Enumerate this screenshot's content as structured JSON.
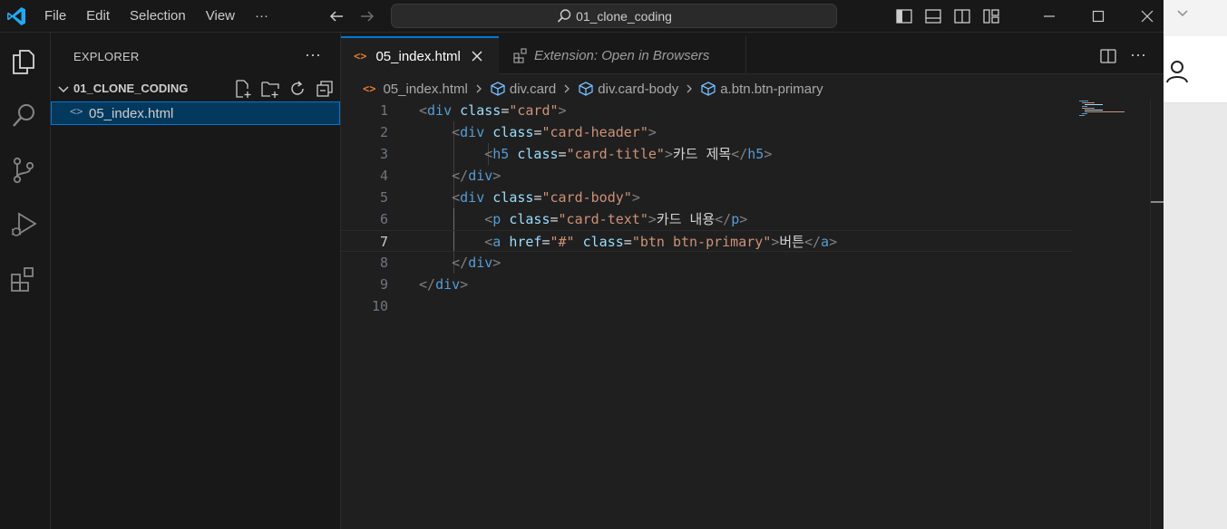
{
  "titlebar": {
    "menu": [
      "File",
      "Edit",
      "Selection",
      "View",
      "···"
    ],
    "command_center": "01_clone_coding"
  },
  "sidebar": {
    "title": "EXPLORER",
    "more": "···",
    "folder_name": "01_CLONE_CODING",
    "file_icon": "<>",
    "files": [
      "05_index.html"
    ]
  },
  "tabs": {
    "active": "05_index.html",
    "inactive": "Extension: Open in Browsers",
    "html_icon": "<>"
  },
  "editor_actions": {
    "more": "···"
  },
  "breadcrumb": {
    "html_icon": "<>",
    "file": "05_index.html",
    "items": [
      "div.card",
      "div.card-body",
      "a.btn.btn-primary"
    ]
  },
  "code": {
    "line_numbers": [
      "1",
      "2",
      "3",
      "4",
      "5",
      "6",
      "7",
      "8",
      "9",
      "10"
    ],
    "active_line": 7
  },
  "colors": {
    "accent": "#0078d4",
    "tag": "#569cd6",
    "attribute": "#9cdcfe",
    "string": "#ce9178",
    "html_icon": "#e37933"
  }
}
